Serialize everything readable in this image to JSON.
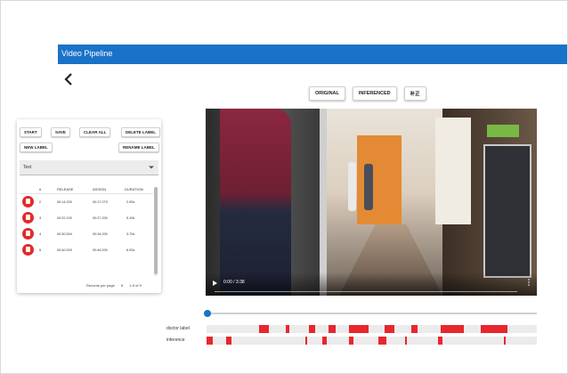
{
  "header": {
    "title": "Video Pipeline"
  },
  "view_tabs": [
    "ORIGINAL",
    "INFERENCED",
    "补正"
  ],
  "toolbar": {
    "start": "START",
    "save": "SAVE",
    "clear_all": "CLEAR ALL",
    "delete_label": "DELETE LABEL",
    "new_label": "NEW LABEL",
    "rename_label": "RENAME LABEL"
  },
  "label_select": {
    "value": "Test"
  },
  "table": {
    "columns": [
      "#",
      "RELEASE",
      "ASSIGN",
      "DURATION"
    ],
    "rows": [
      {
        "index": "2",
        "release": "00:14.200",
        "assign": "00:17.070",
        "duration": "2.90s"
      },
      {
        "index": "3",
        "release": "00:22.100",
        "assign": "00:27.200",
        "duration": "5.10s"
      },
      {
        "index": "4",
        "release": "00:30.504",
        "assign": "00:34.200",
        "duration": "3.70s"
      },
      {
        "index": "5",
        "release": "00:40.000",
        "assign": "00:46.200",
        "duration": "6.00s"
      }
    ]
  },
  "pagination": {
    "rows_label": "Records per page",
    "rows_value": "5",
    "range": "1-5 of 9"
  },
  "video": {
    "time": "0:00 / 3:38",
    "progress": 0
  },
  "tracks": {
    "doctor_label": "doctor label",
    "inference": "inference",
    "doctor_segments": [
      [
        0.16,
        0.19
      ],
      [
        0.24,
        0.25
      ],
      [
        0.31,
        0.33
      ],
      [
        0.37,
        0.39
      ],
      [
        0.43,
        0.49
      ],
      [
        0.54,
        0.57
      ],
      [
        0.62,
        0.64
      ],
      [
        0.71,
        0.78
      ],
      [
        0.83,
        0.91
      ]
    ],
    "inference_segments": [
      [
        0.0,
        0.02
      ],
      [
        0.06,
        0.075
      ],
      [
        0.3,
        0.305
      ],
      [
        0.35,
        0.365
      ],
      [
        0.43,
        0.445
      ],
      [
        0.52,
        0.545
      ],
      [
        0.6,
        0.605
      ],
      [
        0.7,
        0.715
      ],
      [
        0.9,
        0.905
      ]
    ]
  },
  "colors": {
    "accent": "#1a73c8",
    "segment": "#e8262d",
    "delete": "#e4292c"
  },
  "icons": [
    "back-arrow-icon",
    "chevron-down-icon",
    "trash-icon",
    "play-icon",
    "more-vert-icon"
  ]
}
